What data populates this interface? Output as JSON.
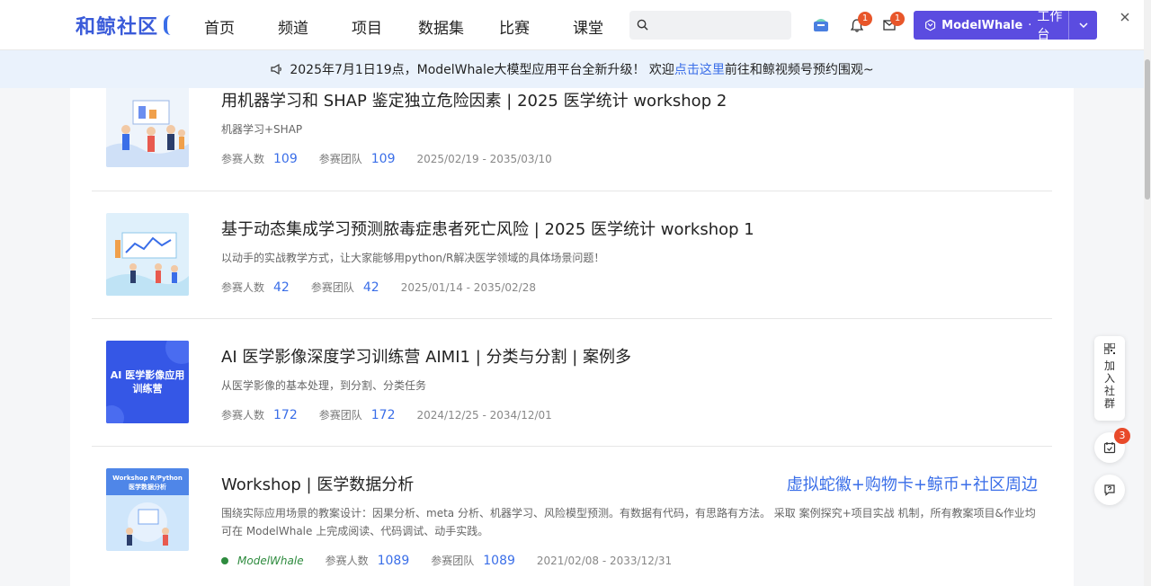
{
  "header": {
    "logo": "和鲸社区",
    "nav": [
      "首页",
      "频道",
      "项目",
      "数据集",
      "比赛",
      "课堂"
    ],
    "search_placeholder": "",
    "notifications_count": "1",
    "messages_count": "1",
    "workbench_brand": "ModelWhale",
    "workbench_label": "工作台"
  },
  "notice": {
    "prefix": "2025年7月1日19点，ModelWhale大模型应用平台全新升级！ 欢迎",
    "link": "点击这里",
    "suffix": "前往和鲸视频号预约围观~"
  },
  "labels": {
    "participants": "参赛人数",
    "teams": "参赛团队"
  },
  "competitions": [
    {
      "title": "用机器学习和 SHAP 鉴定独立危险因素 | 2025 医学统计 workshop 2",
      "desc": "机器学习+SHAP",
      "participants": "109",
      "teams": "109",
      "dates": "2025/02/19 - 2035/03/10"
    },
    {
      "title": "基于动态集成学习预测脓毒症患者死亡风险 | 2025 医学统计 workshop 1",
      "desc": "以动手的实战教学方式，让大家能够用python/R解决医学领域的具体场景问题！",
      "participants": "42",
      "teams": "42",
      "dates": "2025/01/14 - 2035/02/28"
    },
    {
      "title": "AI 医学影像深度学习训练营 AIMI1 | 分类与分割 | 案例多",
      "desc": "从医学影像的基本处理，到分割、分类任务",
      "participants": "172",
      "teams": "172",
      "dates": "2024/12/25 - 2034/12/01",
      "thumb_text": "AI 医学影像应用训练营"
    },
    {
      "title": "Workshop | 医学数据分析",
      "desc": "围绕实际应用场景的教案设计：因果分析、meta 分析、机器学习、风险模型预测。有数据有代码，有思路有方法。 采取 案例探究+项目实战 机制，所有教案项目&作业均可在 ModelWhale 上完成阅读、代码调试、动手实践。",
      "promo": "虚拟蛇徽+购物卡+鲸币+社区周边",
      "host": "ModelWhale",
      "participants": "1089",
      "teams": "1089",
      "dates": "2021/02/08 - 2033/12/31",
      "thumb_text": "Workshop R/Python 医学数据分析"
    }
  ],
  "sidebar": {
    "join_label": "加入社群",
    "tasks_badge": "3"
  },
  "colors": {
    "brand": "#3a5bd9",
    "accent": "#5b4ce0",
    "link": "#3a6ee8",
    "badge": "#e8562a"
  }
}
